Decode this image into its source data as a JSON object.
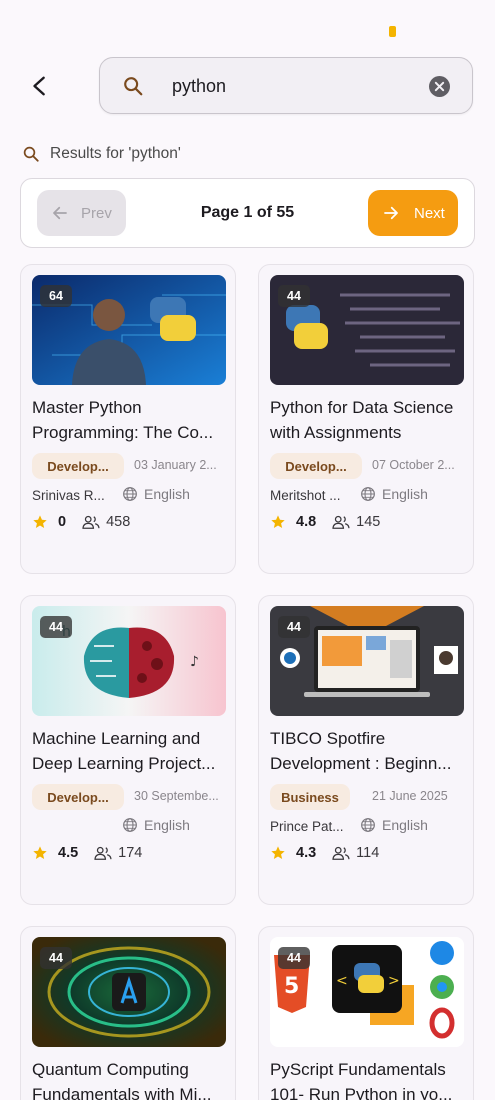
{
  "search": {
    "value": "python",
    "placeholder": ""
  },
  "results_label": "Results for 'python'",
  "pager": {
    "prev": "Prev",
    "page_indicator": "Page 1 of 55",
    "next": "Next"
  },
  "colors": {
    "accent": "#f59c11",
    "star": "#f4b400",
    "category_bg": "#f7ebe1",
    "category_text": "#7a4a1e"
  },
  "courses": [
    {
      "badge": "64",
      "title_line1": "Master Python",
      "title_line2": "Programming: The Co...",
      "category": "Develop...",
      "date": "03 January 2...",
      "author": "Srinivas R...",
      "language": "English",
      "rating": "0",
      "students": "458"
    },
    {
      "badge": "44",
      "title_line1": "Python for Data Science",
      "title_line2": "with Assignments",
      "category": "Develop...",
      "date": "07 October 2...",
      "author": "Meritshot ...",
      "language": "English",
      "rating": "4.8",
      "students": "145"
    },
    {
      "badge": "44",
      "title_line1": "Machine Learning and",
      "title_line2": "Deep Learning Project...",
      "category": "Develop...",
      "date": "30 Septembe...",
      "author": "",
      "language": "English",
      "rating": "4.5",
      "students": "174"
    },
    {
      "badge": "44",
      "title_line1": "TIBCO Spotfire",
      "title_line2": "Development : Beginn...",
      "category": "Business",
      "date": "21 June 2025",
      "author": "Prince Pat...",
      "language": "English",
      "rating": "4.3",
      "students": "114"
    },
    {
      "badge": "44",
      "title_line1": "Quantum Computing",
      "title_line2": "Fundamentals with Mi...",
      "category": "",
      "date": "",
      "author": "",
      "language": "",
      "rating": "",
      "students": ""
    },
    {
      "badge": "44",
      "title_line1": "PyScript Fundamentals",
      "title_line2": "101- Run Python in yo...",
      "category": "",
      "date": "",
      "author": "",
      "language": "",
      "rating": "",
      "students": ""
    }
  ],
  "icons": {
    "back": "arrow-back-icon",
    "search": "search-icon",
    "clear": "clear-icon",
    "prev": "arrow-left-icon",
    "next": "arrow-right-icon",
    "star": "star-icon",
    "students": "people-icon",
    "language": "globe-icon"
  }
}
